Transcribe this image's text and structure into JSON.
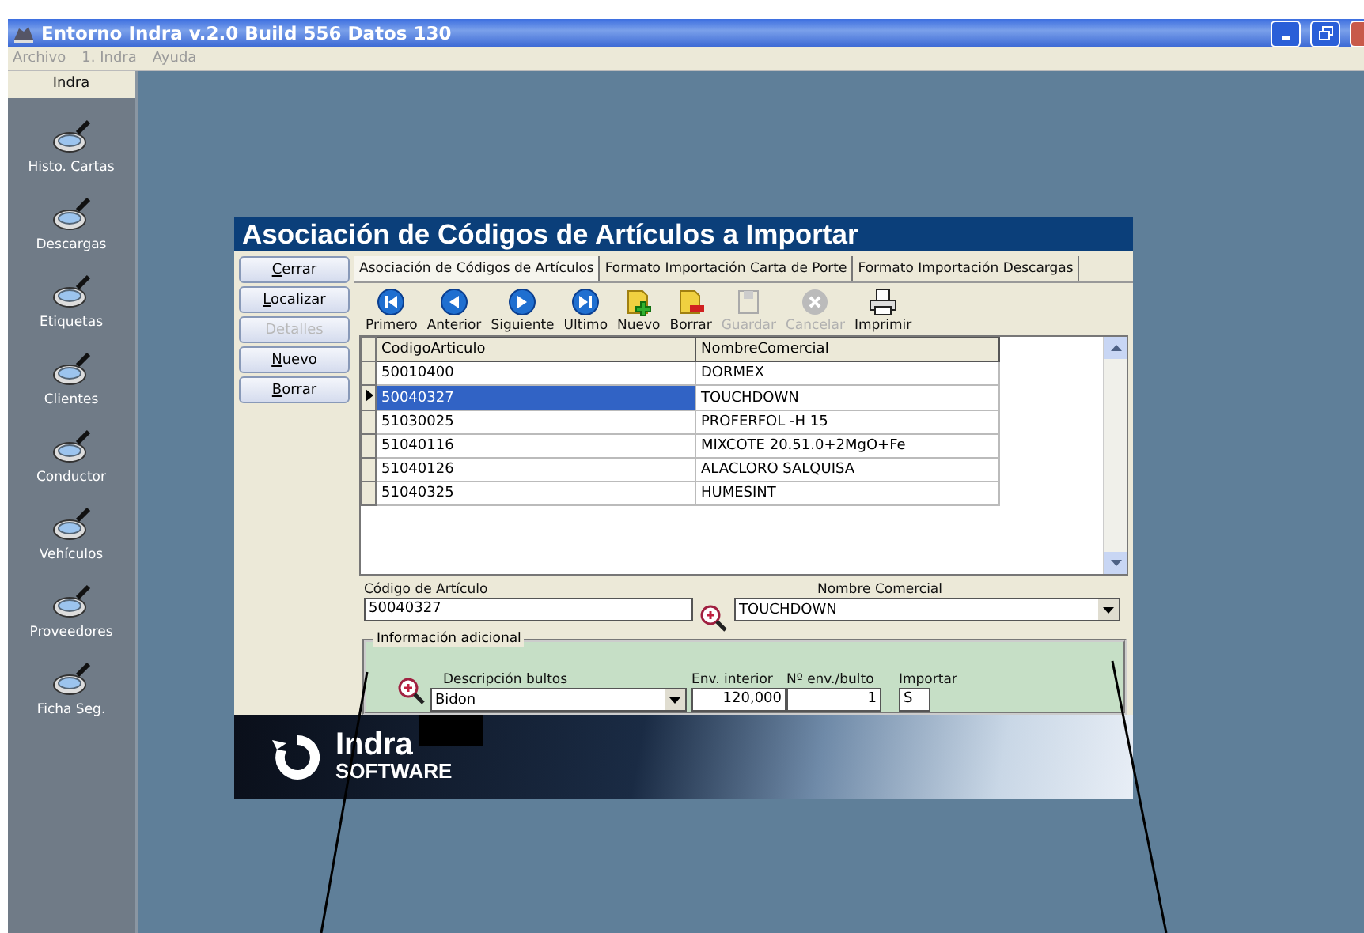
{
  "window": {
    "title": "Entorno Indra v.2.0 Build 556 Datos 130"
  },
  "menu": [
    {
      "label": "Archivo",
      "disabled": true
    },
    {
      "label": "1. Indra",
      "disabled": true
    },
    {
      "label": "Ayuda",
      "disabled": true
    }
  ],
  "sidebar": {
    "header": "Indra",
    "items": [
      {
        "label": "Histo. Cartas"
      },
      {
        "label": "Descargas"
      },
      {
        "label": "Etiquetas"
      },
      {
        "label": "Clientes"
      },
      {
        "label": "Conductor"
      },
      {
        "label": "Vehículos"
      },
      {
        "label": "Proveedores"
      },
      {
        "label": "Ficha Seg."
      }
    ]
  },
  "dialog": {
    "title": "Asociación de Códigos de Artículos a Importar",
    "buttons": [
      {
        "label": "Cerrar",
        "disabled": false
      },
      {
        "label": "Localizar",
        "disabled": false
      },
      {
        "label": "Detalles",
        "disabled": true
      },
      {
        "label": "Nuevo",
        "disabled": false
      },
      {
        "label": "Borrar",
        "disabled": false
      }
    ],
    "tabs": [
      {
        "label": "Asociación de Códigos de Artículos",
        "selected": true
      },
      {
        "label": "Formato Importación Carta de Porte",
        "selected": false
      },
      {
        "label": "Formato Importación Descargas",
        "selected": false
      }
    ],
    "toolbar": [
      {
        "kind": "first",
        "label": "Primero",
        "disabled": false
      },
      {
        "kind": "prev",
        "label": "Anterior",
        "disabled": false
      },
      {
        "kind": "next",
        "label": "Siguiente",
        "disabled": false
      },
      {
        "kind": "last",
        "label": "Ultimo",
        "disabled": false
      },
      {
        "kind": "add",
        "label": "Nuevo",
        "disabled": false
      },
      {
        "kind": "delete",
        "label": "Borrar",
        "disabled": false
      },
      {
        "kind": "save",
        "label": "Guardar",
        "disabled": true
      },
      {
        "kind": "cancel",
        "label": "Cancelar",
        "disabled": true
      },
      {
        "kind": "print",
        "label": "Imprimir",
        "disabled": false
      }
    ],
    "table": {
      "columns": [
        "CodigoArticulo",
        "NombreComercial"
      ],
      "rows": [
        {
          "cells": [
            "50010400",
            "DORMEX"
          ],
          "selected": false
        },
        {
          "cells": [
            "50040327",
            "TOUCHDOWN"
          ],
          "selected": true
        },
        {
          "cells": [
            "51030025",
            "PROFERFOL -H 15"
          ],
          "selected": false
        },
        {
          "cells": [
            "51040116",
            "MIXCOTE 20.51.0+2MgO+Fe"
          ],
          "selected": false
        },
        {
          "cells": [
            "51040126",
            "ALACLORO SALQUISA"
          ],
          "selected": false
        },
        {
          "cells": [
            "51040325",
            "HUMESINT"
          ],
          "selected": false
        }
      ]
    },
    "codigo": {
      "label": "Código de Artículo",
      "value": "50040327"
    },
    "nombre": {
      "label": "Nombre Comercial",
      "value": "TOUCHDOWN"
    },
    "info": {
      "title": "Información adicional",
      "descripcion": {
        "label": "Descripción bultos",
        "value": "Bidon"
      },
      "env_interior": {
        "label": "Env. interior",
        "value": "120,000"
      },
      "env_bulto": {
        "label": "Nº env./bulto",
        "value": "1"
      },
      "importar": {
        "label": "Importar",
        "value": "S"
      }
    },
    "banner": {
      "brand": "Indra",
      "sub": "SOFTWARE"
    }
  }
}
